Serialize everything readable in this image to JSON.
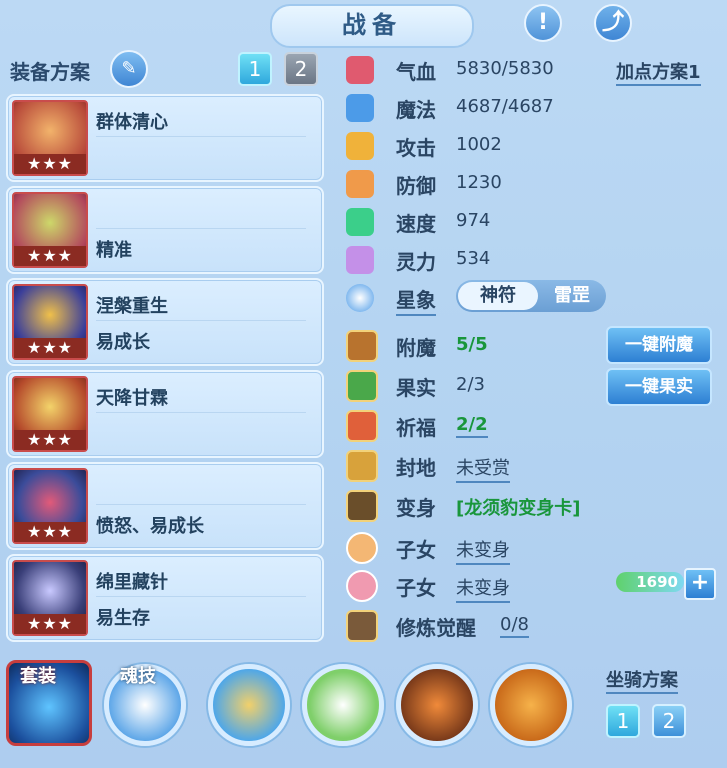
{
  "header": {
    "title": "战备",
    "alert_icon": "exclamation-icon",
    "share_icon": "share-icon"
  },
  "equipment": {
    "label": "装备方案",
    "plans": [
      "1",
      "2"
    ],
    "active_plan": "1",
    "cards": [
      {
        "name": "群体清心",
        "desc": "",
        "stars": "★★★"
      },
      {
        "name": "",
        "desc": "精准",
        "stars": "★★★"
      },
      {
        "name": "涅槃重生",
        "desc": "易成长",
        "stars": "★★★"
      },
      {
        "name": "天降甘霖",
        "desc": "",
        "stars": "★★★"
      },
      {
        "name": "",
        "desc": "愤怒、易成长",
        "stars": "★★★"
      },
      {
        "name": "绵里藏针",
        "desc": "易生存",
        "stars": "★★★"
      }
    ]
  },
  "stats": {
    "add_point_plan": "加点方案1",
    "rows": [
      {
        "label": "气血",
        "value": "5830/5830",
        "color": "#e05a6f"
      },
      {
        "label": "魔法",
        "value": "4687/4687",
        "color": "#4c9be8"
      },
      {
        "label": "攻击",
        "value": "1002",
        "color": "#f0b23a"
      },
      {
        "label": "防御",
        "value": "1230",
        "color": "#f09a4a"
      },
      {
        "label": "速度",
        "value": "974",
        "color": "#3bcf8a"
      },
      {
        "label": "灵力",
        "value": "534",
        "color": "#c490e8"
      }
    ],
    "star": {
      "label": "星象",
      "options": [
        "神符",
        "雷罡"
      ],
      "selected": "神符"
    }
  },
  "enhance": {
    "rows": [
      {
        "label": "附魔",
        "value": "5/5"
      },
      {
        "label": "果实",
        "value": "2/3"
      },
      {
        "label": "祈福",
        "value": "2/2"
      },
      {
        "label": "封地",
        "value": "未受赏"
      },
      {
        "label": "变身",
        "value": "[龙须豹变身卡]"
      },
      {
        "label": "子女",
        "value": "未变身"
      },
      {
        "label": "子女",
        "value": "未变身"
      },
      {
        "label": "修炼觉醒",
        "value": "0/8"
      }
    ],
    "btn_enchant": "一键附魔",
    "btn_fruit": "一键果实",
    "child_power": "1690",
    "plus": "+"
  },
  "bottom": {
    "suit_label": "套装",
    "soul_label": "魂技",
    "mount_plan_label": "坐骑方案",
    "mount_plans": [
      "1",
      "2"
    ]
  }
}
